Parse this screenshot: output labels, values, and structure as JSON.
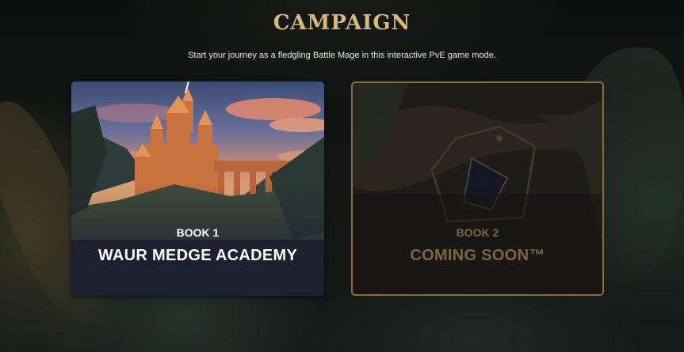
{
  "header": {
    "title": "CAMPAIGN",
    "subtitle": "Start your journey as a fledgling Battle Mage in this interactive PvE game mode."
  },
  "books": [
    {
      "book_label": "BOOK 1",
      "name": "WAUR MEDGE ACADEMY",
      "state": "available"
    },
    {
      "book_label": "BOOK 2",
      "name": "COMING SOON™",
      "state": "locked"
    }
  ],
  "colors": {
    "title_gold": "#d9b97a",
    "locked_border": "#8c6d3a",
    "locked_text": "#7a6640",
    "available_text": "#ffffff"
  }
}
